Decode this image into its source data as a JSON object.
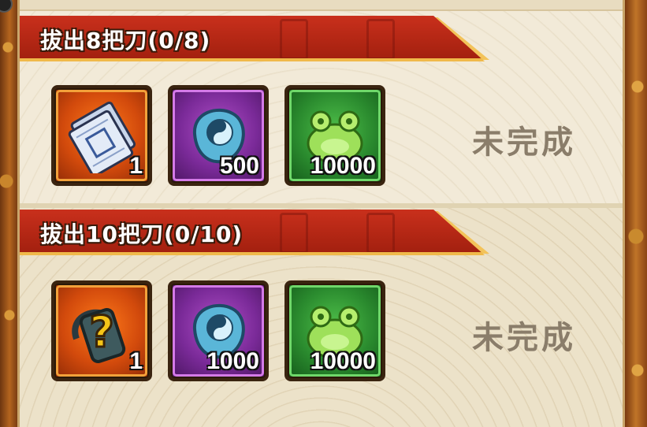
{
  "quests": [
    {
      "title": "拔出8把刀(0/8)",
      "status": "未完成",
      "rewards": [
        {
          "icon": "ticket-scroll-icon",
          "count": "1",
          "rarity": "orange"
        },
        {
          "icon": "blue-yinyang-orb-icon",
          "count": "500",
          "rarity": "purple"
        },
        {
          "icon": "green-frog-icon",
          "count": "10000",
          "rarity": "green"
        }
      ]
    },
    {
      "title": "拔出10把刀(0/10)",
      "status": "未完成",
      "rewards": [
        {
          "icon": "mystery-chest-icon",
          "count": "1",
          "rarity": "orange"
        },
        {
          "icon": "blue-yinyang-orb-icon",
          "count": "1000",
          "rarity": "purple"
        },
        {
          "icon": "green-frog-icon",
          "count": "10000",
          "rarity": "green"
        }
      ]
    }
  ],
  "colors": {
    "banner_red": "#b8281a",
    "banner_gold": "#f0b94a",
    "status_text": "#8a7d6a",
    "panel_bg": "#f1e9d6"
  }
}
